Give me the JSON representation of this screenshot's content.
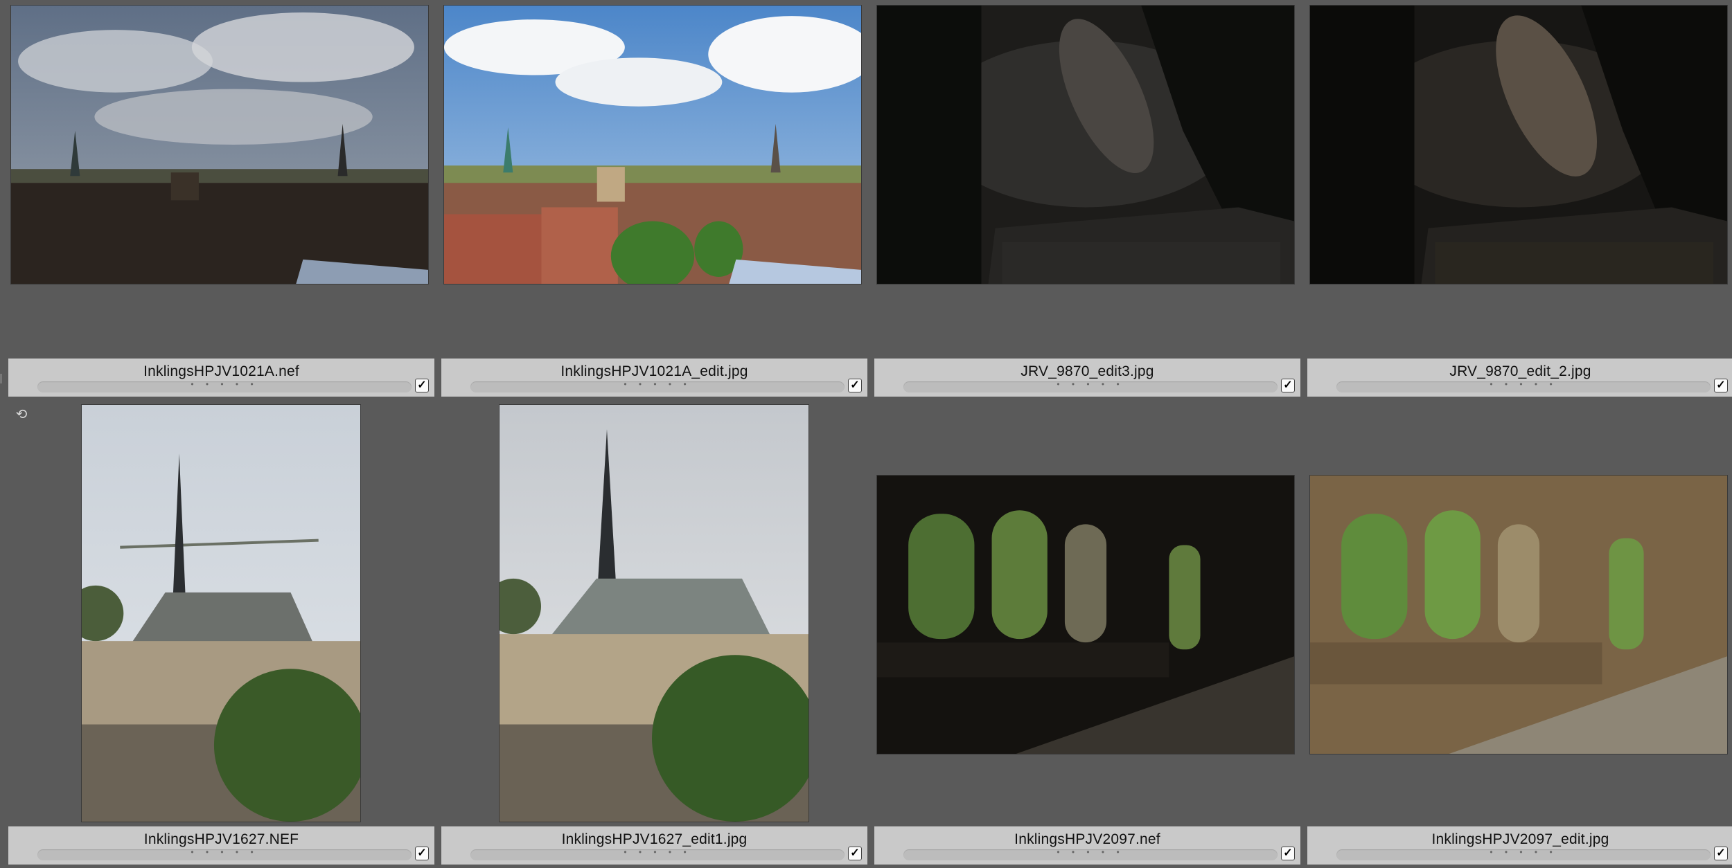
{
  "items": [
    {
      "filename": "InklingsHPJV1021A.nef",
      "rating": "• • • • •",
      "checked": "✓"
    },
    {
      "filename": "InklingsHPJV1021A_edit.jpg",
      "rating": "• • • • •",
      "checked": "✓"
    },
    {
      "filename": "JRV_9870_edit3.jpg",
      "rating": "• • • • •",
      "checked": "✓"
    },
    {
      "filename": "JRV_9870_edit_2.jpg",
      "rating": "• • • • •",
      "checked": "✓"
    },
    {
      "filename": "InklingsHPJV1627.NEF",
      "rating": "• • • • •",
      "checked": "✓"
    },
    {
      "filename": "InklingsHPJV1627_edit1.jpg",
      "rating": "• • • • •",
      "checked": "✓"
    },
    {
      "filename": "InklingsHPJV2097.nef",
      "rating": "• • • • •",
      "checked": "✓"
    },
    {
      "filename": "InklingsHPJV2097_edit.jpg",
      "rating": "• • • • •",
      "checked": "✓"
    }
  ],
  "icons": {
    "row_icon": "rotate-icon"
  }
}
